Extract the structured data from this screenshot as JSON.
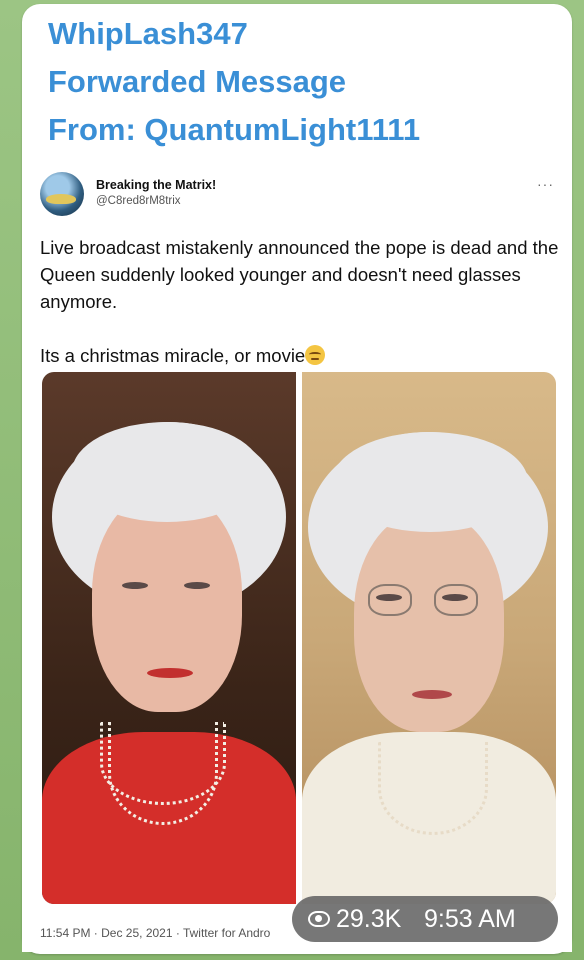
{
  "message": {
    "header_lines": [
      "WhipLash347",
      "Forwarded Message",
      "From: QuantumLight1111"
    ],
    "accent_color": "#3a8fd6"
  },
  "tweet": {
    "author_name": "Breaking the Matrix!",
    "author_handle": "@C8red8rM8trix",
    "more_label": "···",
    "text_para1": "Live broadcast mistakenly announced the pope is dead and the Queen suddenly looked younger and doesn't need glasses anymore.",
    "text_para2": "Its a christmas miracle, or movie",
    "emoji_icon": "smirking-face-icon",
    "meta": "11:54 PM · Dec 25, 2021 · Twitter for Andro"
  },
  "overlay": {
    "icon": "eye-icon",
    "views": "29.3K",
    "time": "9:53 AM"
  }
}
